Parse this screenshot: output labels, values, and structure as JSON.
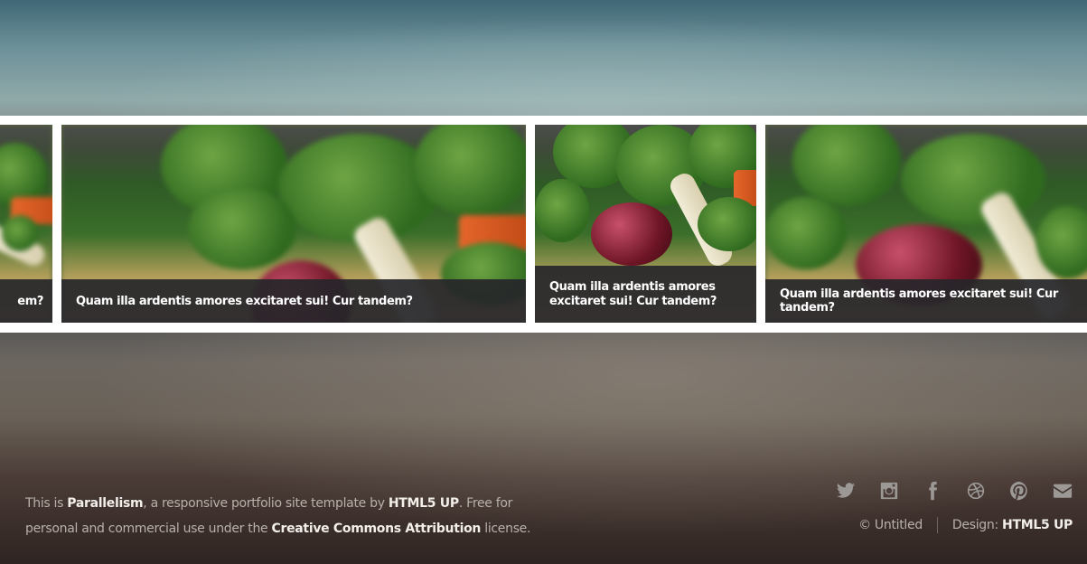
{
  "reel": {
    "cards": [
      {
        "caption": "em?"
      },
      {
        "caption": "Quam illa ardentis amores excitaret sui! Cur tandem?"
      },
      {
        "caption": "Quam illa ardentis amores excitaret sui! Cur tandem?"
      },
      {
        "caption": "Quam illa ardentis amores excitaret sui! Cur tandem?"
      }
    ]
  },
  "footer": {
    "text_prefix": "This is ",
    "site_name": "Parallelism",
    "text_mid": ", a responsive portfolio site template by ",
    "author": "HTML5 UP",
    "text_mid2": ". Free for personal and commercial use under the ",
    "license": "Creative Commons Attribution",
    "text_suffix": " license.",
    "copyright": "© Untitled",
    "design_label": "Design: ",
    "design_link": "HTML5 UP",
    "icons": [
      "twitter-icon",
      "instagram-icon",
      "facebook-icon",
      "dribbble-icon",
      "pinterest-icon",
      "envelope-icon"
    ]
  }
}
